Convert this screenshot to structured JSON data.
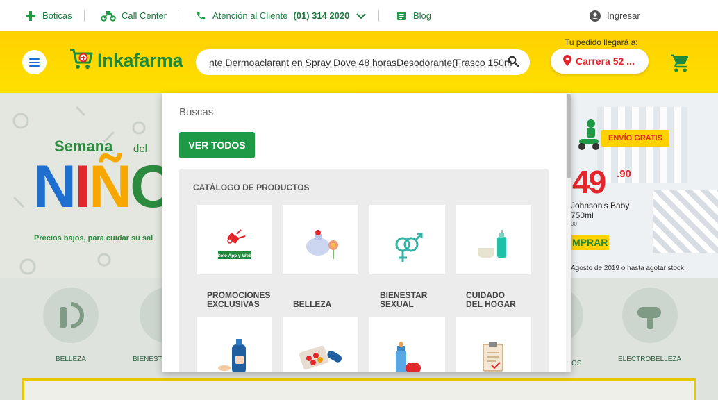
{
  "topbar": {
    "boticas": "Boticas",
    "call_center": "Call Center",
    "atencion": "Atención al Cliente",
    "phone": "(01) 314 2020",
    "blog": "Blog",
    "login": "Ingresar"
  },
  "header": {
    "logo": "Inkafarma",
    "search_value": "nte Dermoaclarant en Spray Dove 48 horasDesodorante(Frasco 150ml)",
    "delivery_label": "Tu pedido llegará a:",
    "delivery_address": "Carrera 52 ..."
  },
  "hero": {
    "semana": "Semana",
    "del": "del",
    "nino": [
      "N",
      "I",
      "Ñ",
      "O"
    ],
    "subtitle": "Precios bajos, para cuidar su sal",
    "envio": "ENVÍO GRATIS",
    "price": "49",
    "price_decimals": ".90",
    "product_name_line1": "Johnson's Baby",
    "product_name_line2": "750ml",
    "product_old_price": "00",
    "comprar": "MPRAR",
    "legal": "Agosto de 2019 o hasta agotar stock."
  },
  "categories_bg": [
    {
      "label": "BELLEZA"
    },
    {
      "label": "BIENEST"
    },
    {
      "label": "OS"
    },
    {
      "label": "ELECTROBELLEZA"
    }
  ],
  "dropdown": {
    "title": "Buscas",
    "see_all": "VER TODOS",
    "catalog_title": "CATÁLOGO DE PRODUCTOS",
    "row1": [
      {
        "label": "PROMOCIONES EXCLUSIVAS",
        "icon": "promo-tag-icon",
        "badge": "Solo App y Web"
      },
      {
        "label": "BELLEZA",
        "icon": "perfume-icon"
      },
      {
        "label": "BIENESTAR SEXUAL",
        "icon": "gender-symbols-icon"
      },
      {
        "label": "CUIDADO DEL HOGAR",
        "icon": "household-cleaning-icon"
      }
    ],
    "row2": [
      {
        "icon": "soap-bottle-icon"
      },
      {
        "icon": "pills-icon"
      },
      {
        "icon": "baby-bottle-icon"
      },
      {
        "icon": "clipboard-icon"
      }
    ]
  },
  "colors": {
    "brand_green": "#1e8a3e",
    "brand_yellow": "#ffd100",
    "accent_red": "#e3262c",
    "button_green": "#1e9a46"
  }
}
